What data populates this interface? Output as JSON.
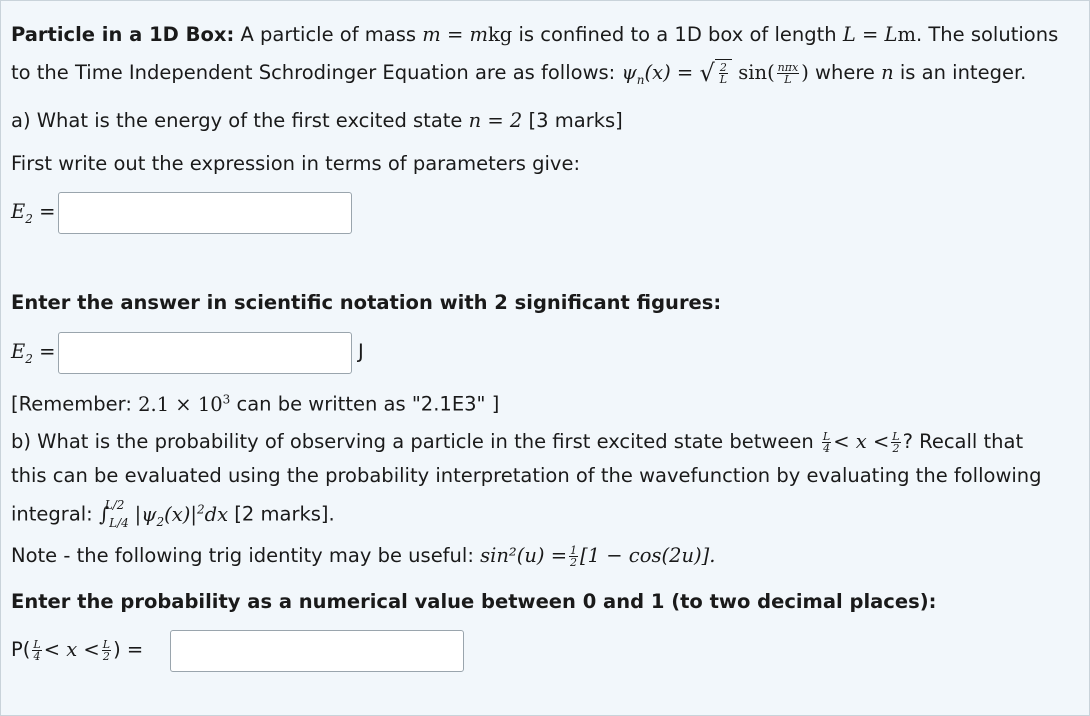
{
  "intro": {
    "title": "Particle in a 1D Box:",
    "text1": "A particle of mass",
    "mass_expr": "m = m",
    "mass_unit": "kg",
    "text2": "is confined to a 1D box of length",
    "length_expr": "L = L",
    "length_unit": "m",
    "text3": ". The solutions",
    "text4": "to the Time Independent Schrodinger Equation are as follows:",
    "psi_expr": "ψ",
    "text5": "where",
    "n_var": "n",
    "text6": "is an integer."
  },
  "part_a": {
    "question": "a) What is the energy of the first excited state",
    "n_eq": "n = 2",
    "marks": "[3 marks]",
    "instruction": "First write out the expression in terms of parameters give:",
    "label1": "E",
    "label1_sub": "2",
    "equals": " =",
    "answer1_value": "",
    "sci_instruction": "Enter the answer in scientific notation with 2 significant figures:",
    "answer2_value": "",
    "unit": "J",
    "reminder_pre": "[Remember:",
    "reminder_math": "2.1 × 10",
    "reminder_exp": "3",
    "reminder_post": "can be written as \"2.1E3\" ]"
  },
  "part_b": {
    "question_pre": "b) What is the probability of observing a particle in the first excited state between",
    "question_post": "? Recall that",
    "line2": "this can be evaluated using the probability interpretation of the wavefunction by evaluating the following",
    "integral_pre": "integral:",
    "marks": "[2 marks].",
    "note_pre": "Note - the following trig identity may be useful:",
    "note_math": "sin²(u) =",
    "note_math2": "[1 − cos(2u)].",
    "prob_instruction": "Enter the probability as a numerical value between 0 and 1 (to two decimal places):",
    "prob_label_pre": "P(",
    "prob_label_post": ") =",
    "answer3_value": ""
  }
}
